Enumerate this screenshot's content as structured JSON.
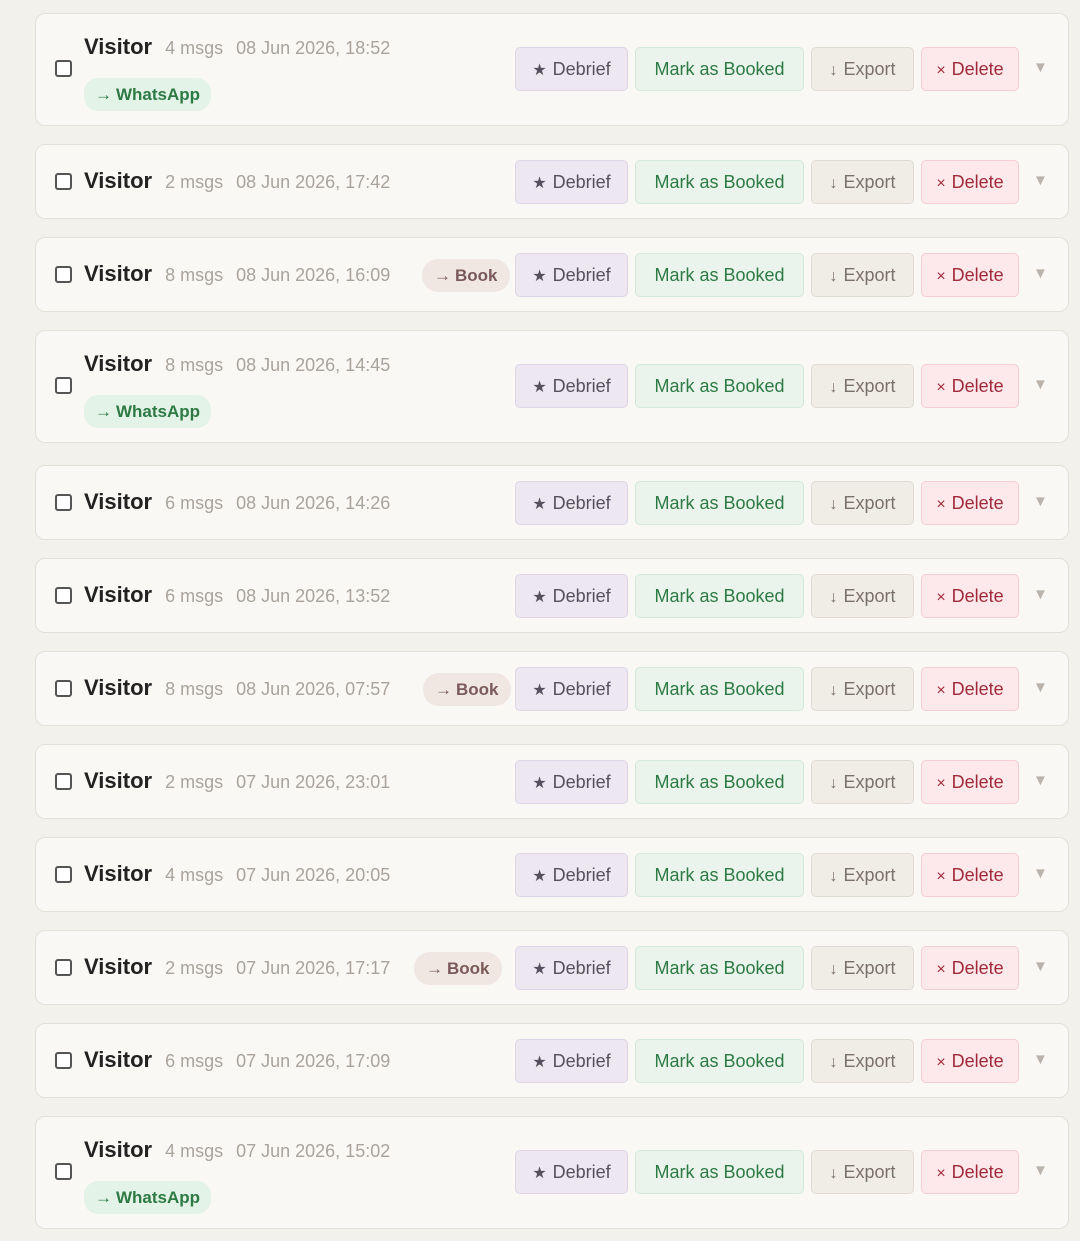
{
  "labels": {
    "debrief": "Debrief",
    "booked": "Mark as Booked",
    "export": "Export",
    "delete": "Delete",
    "book": "Book",
    "whatsapp": "WhatsApp"
  },
  "icons": {
    "debrief": "★",
    "export": "↓",
    "delete": "×",
    "arrow": "→",
    "caret": "▼"
  },
  "conversations": [
    {
      "name": "Visitor",
      "msgs": "4 msgs",
      "date": "08 Jun 2026, 18:52",
      "tag": "whatsapp"
    },
    {
      "name": "Visitor",
      "msgs": "2 msgs",
      "date": "08 Jun 2026, 17:42",
      "tag": ""
    },
    {
      "name": "Visitor",
      "msgs": "8 msgs",
      "date": "08 Jun 2026, 16:09",
      "tag": "book"
    },
    {
      "name": "Visitor",
      "msgs": "8 msgs",
      "date": "08 Jun 2026, 14:45",
      "tag": "whatsapp"
    },
    {
      "name": "Visitor",
      "msgs": "6 msgs",
      "date": "08 Jun 2026, 14:26",
      "tag": ""
    },
    {
      "name": "Visitor",
      "msgs": "6 msgs",
      "date": "08 Jun 2026, 13:52",
      "tag": ""
    },
    {
      "name": "Visitor",
      "msgs": "8 msgs",
      "date": "08 Jun 2026, 07:57",
      "tag": "book"
    },
    {
      "name": "Visitor",
      "msgs": "2 msgs",
      "date": "07 Jun 2026, 23:01",
      "tag": ""
    },
    {
      "name": "Visitor",
      "msgs": "4 msgs",
      "date": "07 Jun 2026, 20:05",
      "tag": ""
    },
    {
      "name": "Visitor",
      "msgs": "2 msgs",
      "date": "07 Jun 2026, 17:17",
      "tag": "book"
    },
    {
      "name": "Visitor",
      "msgs": "6 msgs",
      "date": "07 Jun 2026, 17:09",
      "tag": ""
    },
    {
      "name": "Visitor",
      "msgs": "4 msgs",
      "date": "07 Jun 2026, 15:02",
      "tag": "whatsapp"
    }
  ]
}
